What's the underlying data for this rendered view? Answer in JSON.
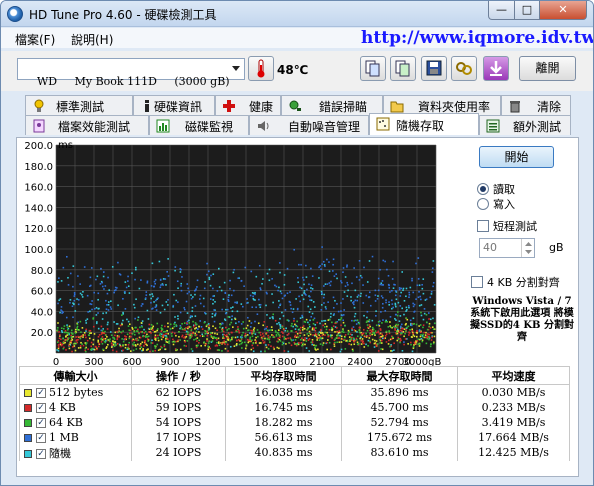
{
  "window": {
    "title": "HD Tune Pro 4.60 - 硬碟檢測工具",
    "minimize": "—",
    "maximize": "□",
    "close": "✕"
  },
  "menu": {
    "file": "檔案(F)",
    "help": "說明(H)"
  },
  "watermark": "http://www.iqmore.idv.tw",
  "toolbar": {
    "drive": "WD     My Book 111D     (3000 gB)",
    "temperature": "48℃",
    "exit": "離開"
  },
  "tabs_row1": [
    {
      "label": "標準測試",
      "icon": "bulb-icon"
    },
    {
      "label": "硬碟資訊",
      "icon": "info-icon"
    },
    {
      "label": "健康",
      "icon": "health-cross-icon"
    },
    {
      "label": "錯誤掃瞄",
      "icon": "scan-icon"
    },
    {
      "label": "資料夾使用率",
      "icon": "folder-icon"
    },
    {
      "label": "清除",
      "icon": "trash-icon"
    }
  ],
  "tabs_row2": [
    {
      "label": "檔案效能測試",
      "icon": "file-icon"
    },
    {
      "label": "磁碟監視",
      "icon": "monitor-icon"
    },
    {
      "label": "自動噪音管理",
      "icon": "speaker-icon"
    },
    {
      "label": "隨機存取",
      "icon": "random-icon"
    },
    {
      "label": "額外測試",
      "icon": "extra-icon"
    }
  ],
  "side": {
    "start": "開始",
    "read": "讀取",
    "write": "寫入",
    "short_test": "短程測試",
    "size_value": "40",
    "size_unit": "gB",
    "align_4kb": "4 KB 分割對齊",
    "note": "Windows Vista / 7 系統下啟用此選項 將模擬SSD的4 KB 分割對齊"
  },
  "colors": {
    "512b": "#e8e830",
    "4kb": "#d42a2a",
    "64kb": "#35b835",
    "1mb": "#2f6fd6",
    "random": "#35c8d8"
  },
  "chart_data": {
    "type": "scatter",
    "ylabel": "ms",
    "xlabel": "",
    "y_unit": "ms",
    "x_unit": "gB",
    "xlim": [
      0,
      3000
    ],
    "ylim": [
      0,
      200
    ],
    "x_ticks": [
      "0",
      "300",
      "600",
      "900",
      "1200",
      "1500",
      "1800",
      "2100",
      "2400",
      "2700",
      "3000gB"
    ],
    "y_ticks": [
      "200.0",
      "180.0",
      "160.0",
      "140.0",
      "120.0",
      "100.0",
      "80.0",
      "60.0",
      "40.0",
      "20.0"
    ],
    "grid": true,
    "series": [
      {
        "name": "512 bytes",
        "color": "#e8e830",
        "y_center": 16.0,
        "y_spread": 7
      },
      {
        "name": "4 KB",
        "color": "#d42a2a",
        "y_center": 16.7,
        "y_spread": 6
      },
      {
        "name": "64 KB",
        "color": "#35b835",
        "y_center": 18.3,
        "y_spread": 8
      },
      {
        "name": "1 MB",
        "color": "#2f6fd6",
        "y_center": 56.6,
        "y_spread": 18
      },
      {
        "name": "隨機",
        "color": "#35c8d8",
        "y_center": 40.8,
        "y_spread": 20
      }
    ]
  },
  "table": {
    "headers": [
      "傳輸大小",
      "操作 / 秒",
      "平均存取時間",
      "最大存取時間",
      "平均速度"
    ],
    "rows": [
      {
        "size": "512 bytes",
        "color": "#e8e830",
        "ops": "62 IOPS",
        "avg": "16.038 ms",
        "max": "35.896 ms",
        "speed": "0.030 MB/s"
      },
      {
        "size": "4 KB",
        "color": "#d42a2a",
        "ops": "59 IOPS",
        "avg": "16.745 ms",
        "max": "45.700 ms",
        "speed": "0.233 MB/s"
      },
      {
        "size": "64 KB",
        "color": "#35b835",
        "ops": "54 IOPS",
        "avg": "18.282 ms",
        "max": "52.794 ms",
        "speed": "3.419 MB/s"
      },
      {
        "size": "1 MB",
        "color": "#2f6fd6",
        "ops": "17 IOPS",
        "avg": "56.613 ms",
        "max": "175.672 ms",
        "speed": "17.664 MB/s"
      },
      {
        "size": "隨機",
        "color": "#35c8d8",
        "ops": "24 IOPS",
        "avg": "40.835 ms",
        "max": "83.610 ms",
        "speed": "12.425 MB/s"
      }
    ]
  }
}
